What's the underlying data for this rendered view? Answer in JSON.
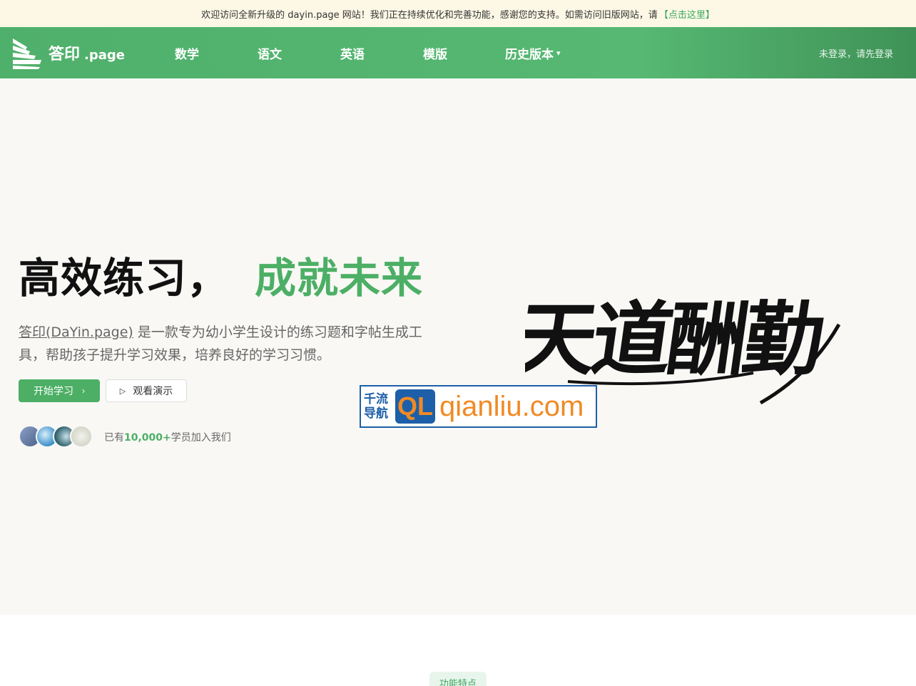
{
  "notice": {
    "text": "欢迎访问全新升级的 dayin.page 网站！我们正在持续优化和完善功能，感谢您的支持。如需访问旧版网站，请",
    "link": "【点击这里】"
  },
  "header": {
    "logo": {
      "name": "答印",
      "suffix": ".page"
    },
    "nav": [
      "数学",
      "语文",
      "英语",
      "模版",
      "历史版本"
    ],
    "login": "未登录，请先登录"
  },
  "hero": {
    "title_main": "高效练习，",
    "title_accent": "成就未来",
    "brand_link": "答印(DaYin.page)",
    "description": " 是一款专为幼小学生设计的练习题和字帖生成工具，帮助孩子提升学习效果，培养良好的学习习惯。",
    "start_button": "开始学习",
    "demo_button": "观看演示",
    "members_prefix": "已有",
    "members_count": "10,000+",
    "members_suffix": "学员加入我们",
    "calligraphy": "天道酬勤"
  },
  "watermark": {
    "cn_line1": "千流",
    "cn_line2": "导航",
    "ql": "QL",
    "domain": "qianliu.com"
  },
  "features_badge": "功能特点",
  "colors": {
    "accent": "#4caf65",
    "nav_bg": "#52b46e",
    "notice_bg": "#fdf8e6",
    "hero_bg": "#f9f8f5"
  }
}
